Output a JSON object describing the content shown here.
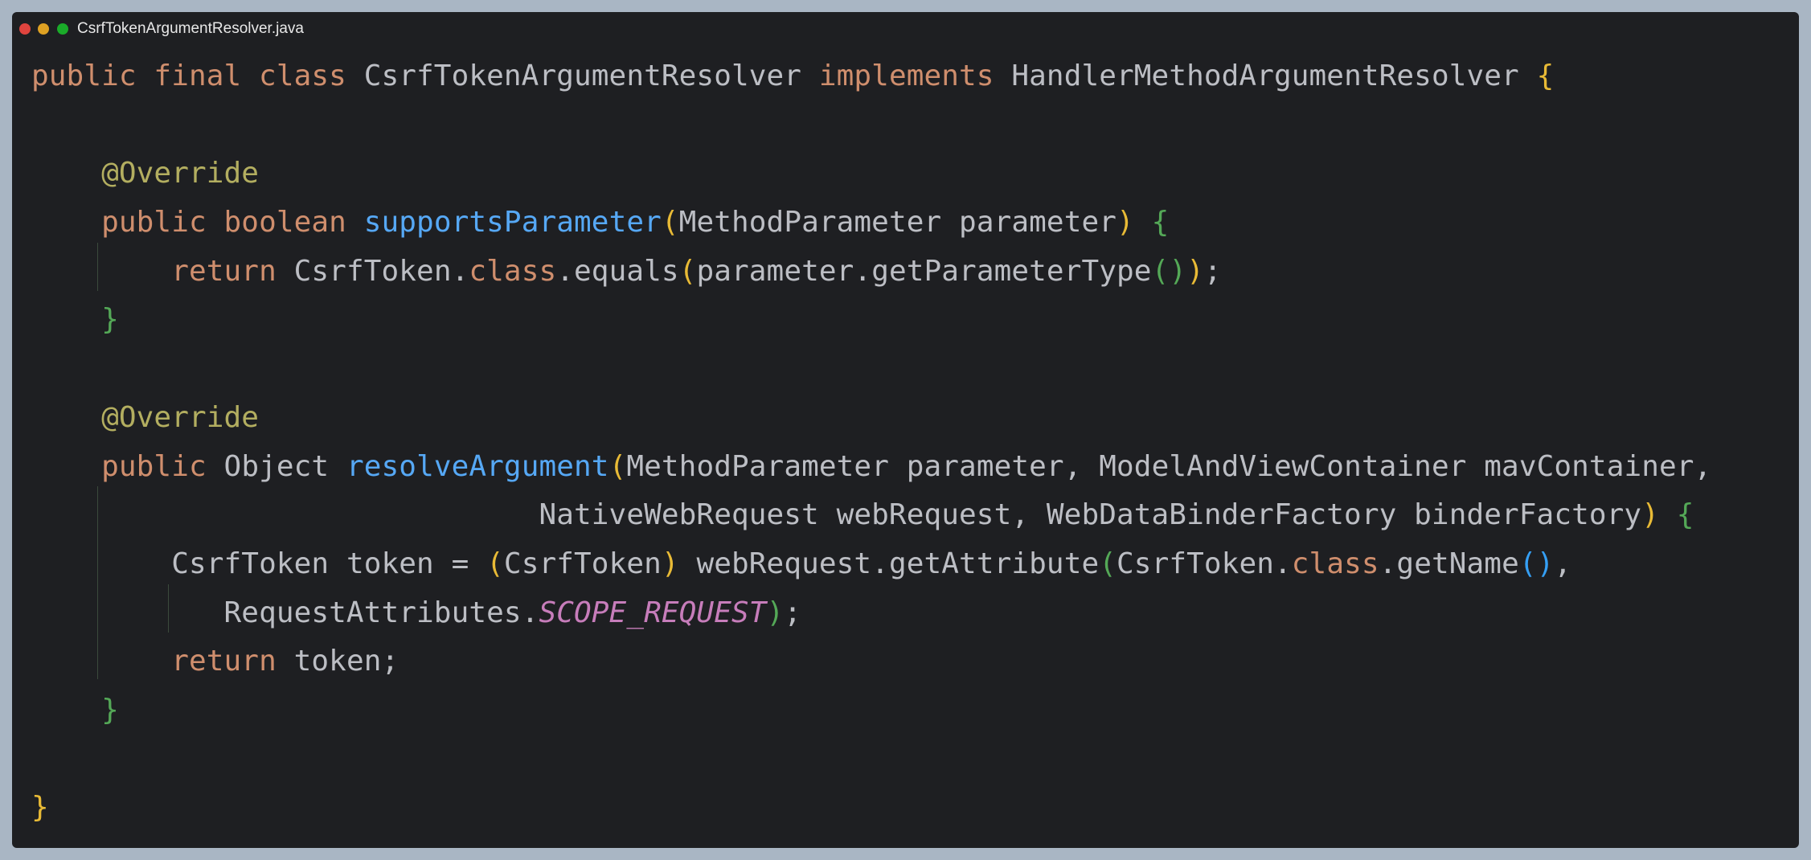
{
  "window": {
    "title": "CsrfTokenArgumentResolver.java",
    "controls": [
      "close",
      "minimize",
      "maximize"
    ]
  },
  "code": {
    "l1": {
      "t1": "public final class",
      "t2": " CsrfTokenArgumentResolver ",
      "t3": "implements",
      "t4": " HandlerMethodArgumentResolver ",
      "t5": "{"
    },
    "l3": {
      "indent": "    ",
      "ann": "@Override"
    },
    "l4": {
      "indent": "    ",
      "t1": "public boolean",
      "t2": " ",
      "fn": "supportsParameter",
      "p1": "(",
      "args": "MethodParameter parameter",
      "p2": ")",
      "t3": " ",
      "p3": "{"
    },
    "l5": {
      "indent": "        ",
      "t1": "return",
      "t2": " CsrfToken.",
      "t3": "class",
      "t4": ".equals",
      "p1": "(",
      "t5": "parameter.getParameterType",
      "p2": "(",
      "p3": ")",
      "p4": ")",
      "t6": ";"
    },
    "l6": {
      "indent": "    ",
      "p1": "}"
    },
    "l8": {
      "indent": "    ",
      "ann": "@Override"
    },
    "l9": {
      "indent": "    ",
      "t1": "public",
      "t2": " Object ",
      "fn": "resolveArgument",
      "p1": "(",
      "args": "MethodParameter parameter, ModelAndViewContainer mavContainer,"
    },
    "l10": {
      "indent": "                             ",
      "args": "NativeWebRequest webRequest, WebDataBinderFactory binderFactory",
      "p1": ")",
      "t1": " ",
      "p2": "{"
    },
    "l11": {
      "indent": "        ",
      "t1": "CsrfToken token = ",
      "p1": "(",
      "t2": "CsrfToken",
      "p2": ")",
      "t3": " webRequest.getAttribute",
      "p3": "(",
      "t4": "CsrfToken.",
      "t5": "class",
      "t6": ".getName",
      "p4": "(",
      "p5": ")",
      "t7": ","
    },
    "l12": {
      "indent": "           ",
      "t1": "RequestAttributes.",
      "st": "SCOPE_REQUEST",
      "p1": ")",
      "t2": ";"
    },
    "l13": {
      "indent": "        ",
      "t1": "return",
      "t2": " token;"
    },
    "l14": {
      "indent": "    ",
      "p1": "}"
    },
    "l16": {
      "p1": "}"
    }
  }
}
